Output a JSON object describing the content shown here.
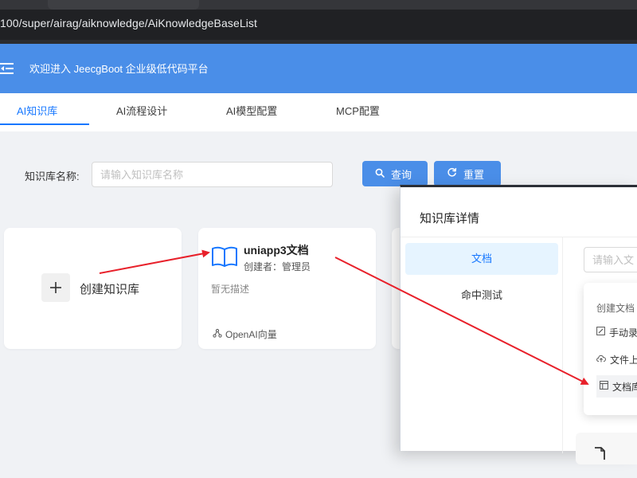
{
  "browser": {
    "url": "100/super/airag/aiknowledge/AiKnowledgeBaseList"
  },
  "header": {
    "title": "欢迎进入 JeecgBoot 企业级低代码平台",
    "bg_color": "#4a8ee8"
  },
  "tabs": [
    {
      "label": "AI知识库",
      "active": true
    },
    {
      "label": "AI流程设计",
      "active": false
    },
    {
      "label": "AI模型配置",
      "active": false
    },
    {
      "label": "MCP配置",
      "active": false
    }
  ],
  "search": {
    "label": "知识库名称:",
    "placeholder": "请输入知识库名称",
    "query_label": "查询",
    "reset_label": "重置"
  },
  "cards": {
    "create_label": "创建知识库",
    "kb": {
      "title": "uniapp3文档",
      "creator": "创建者：管理员",
      "description": "暂无描述",
      "model": "OpenAI向量"
    }
  },
  "modal": {
    "title": "知识库详情",
    "menu": [
      {
        "label": "文档",
        "active": true
      },
      {
        "label": "命中测试",
        "active": false
      }
    ],
    "doc_search_placeholder": "请输入文",
    "dropdown": {
      "label": "创建文档",
      "items": [
        {
          "label": "手动录",
          "icon": "edit-icon"
        },
        {
          "label": "文件上",
          "icon": "cloud-upload-icon"
        },
        {
          "label": "文档库",
          "icon": "library-icon"
        }
      ]
    }
  },
  "accent_color": "#1677ff",
  "annotation_color": "#e8202a"
}
